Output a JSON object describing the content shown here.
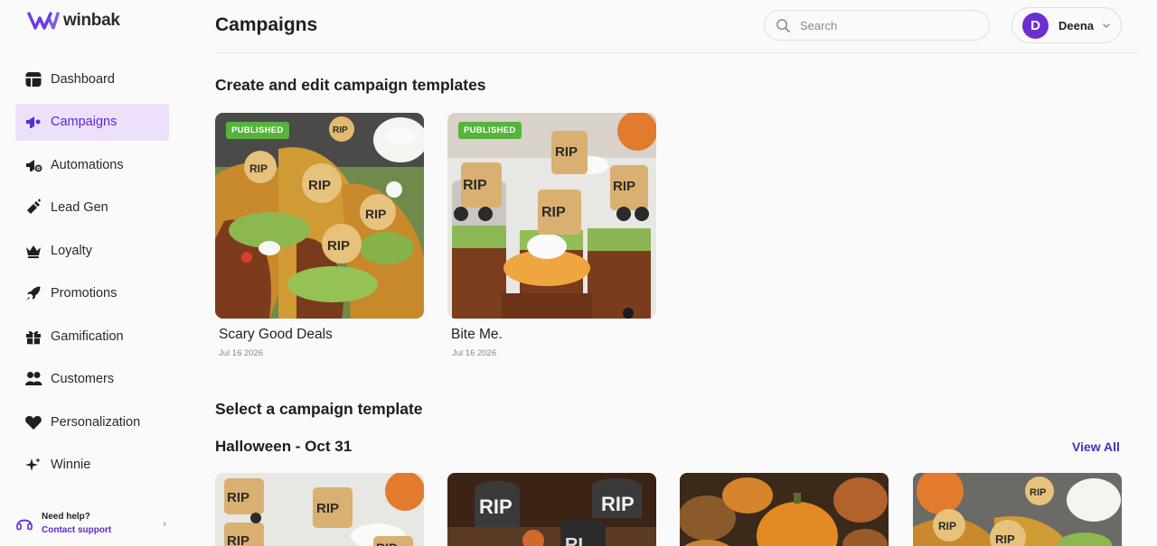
{
  "brand": {
    "name": "winbak",
    "accent": "#5a2bd0",
    "logo_color": "#6a3de8"
  },
  "sidebar": {
    "items": [
      {
        "label": "Dashboard",
        "icon": "dashboard-icon"
      },
      {
        "label": "Campaigns",
        "icon": "megaphone-icon",
        "active": true
      },
      {
        "label": "Automations",
        "icon": "automation-megaphone-icon"
      },
      {
        "label": "Lead Gen",
        "icon": "magnet-icon"
      },
      {
        "label": "Loyalty",
        "icon": "crown-icon"
      },
      {
        "label": "Promotions",
        "icon": "rocket-icon"
      },
      {
        "label": "Gamification",
        "icon": "gift-icon"
      },
      {
        "label": "Customers",
        "icon": "users-icon"
      },
      {
        "label": "Personalization",
        "icon": "heart-icon"
      },
      {
        "label": "Winnie",
        "icon": "sparkles-icon"
      }
    ],
    "help": {
      "title": "Need help?",
      "link": "Contact support",
      "icon": "headset-icon"
    }
  },
  "header": {
    "title": "Campaigns",
    "search_placeholder": "Search",
    "user": {
      "initial": "D",
      "name": "Deena"
    }
  },
  "main": {
    "edit_heading": "Create and edit campaign templates",
    "campaigns": [
      {
        "title": "Scary Good Deals",
        "date": "Jul 16 2026",
        "status": "PUBLISHED"
      },
      {
        "title": "Bite Me.",
        "date": "Jul 16 2026",
        "status": "PUBLISHED"
      }
    ],
    "select_heading": "Select a campaign template",
    "category": {
      "title": "Halloween - Oct 31",
      "view_all": "View All"
    }
  },
  "colors": {
    "published": "#57b33b",
    "active_bg": "#ece0fb",
    "avatar": "#6c2ecf"
  }
}
